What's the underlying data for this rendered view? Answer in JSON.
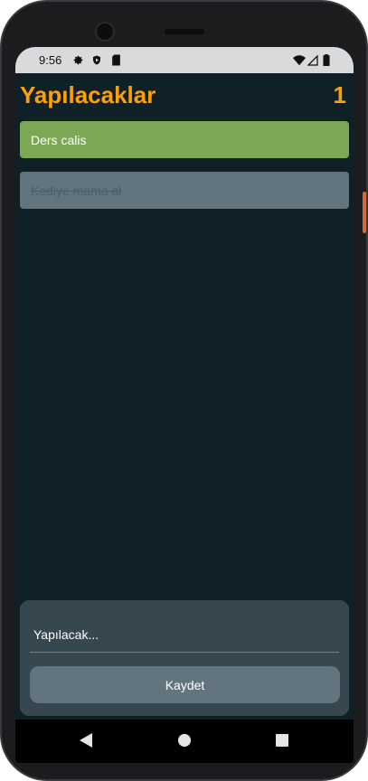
{
  "status_bar": {
    "time": "9:56",
    "left_icons": [
      "gear-icon",
      "shield-icon",
      "sd-card-icon"
    ],
    "right_icons": [
      "wifi-icon",
      "signal-icon",
      "battery-icon"
    ]
  },
  "header": {
    "title": "Yapılacaklar",
    "count": "1"
  },
  "todos": [
    {
      "text": "Ders calis",
      "done": false
    },
    {
      "text": "Kediye mama al",
      "done": true
    }
  ],
  "composer": {
    "placeholder": "Yapılacak...",
    "save_label": "Kaydet"
  },
  "colors": {
    "background": "#102027",
    "accent": "#ffa000",
    "active_item": "#7ca856",
    "done_item": "#62757f",
    "panel": "#37474f"
  },
  "nav_bar": [
    "back-icon",
    "home-icon",
    "recents-icon"
  ]
}
